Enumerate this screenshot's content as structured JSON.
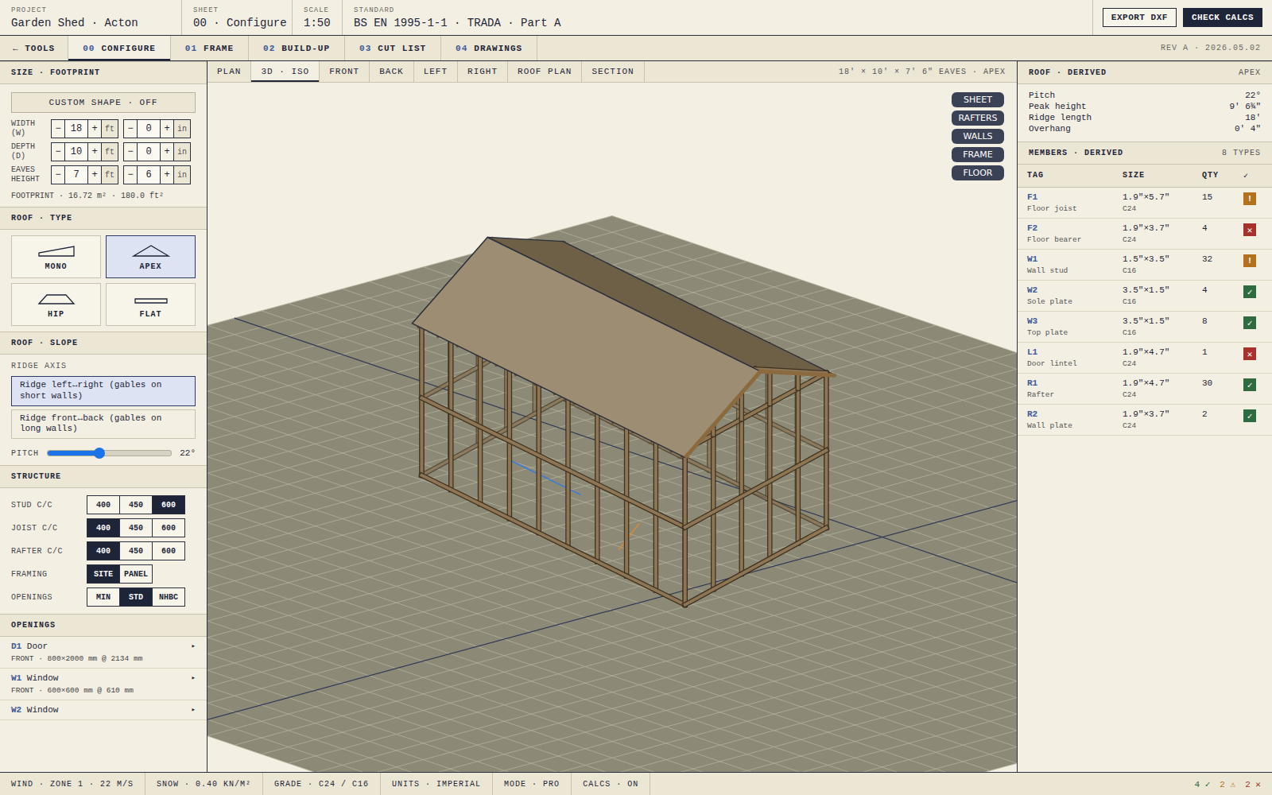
{
  "topbar": {
    "fields": [
      {
        "label": "PROJECT",
        "value": "Garden Shed · Acton"
      },
      {
        "label": "SHEET",
        "value": "00 · Configure"
      },
      {
        "label": "SCALE",
        "value": "1:50"
      },
      {
        "label": "STANDARD",
        "value": "BS EN 1995-1-1 · TRADA · Part A"
      }
    ],
    "buttons": [
      {
        "label": "EXPORT DXF",
        "primary": false
      },
      {
        "label": "CHECK CALCS",
        "primary": true
      }
    ]
  },
  "tabs": {
    "back": "← TOOLS",
    "items": [
      {
        "num": "00",
        "label": "CONFIGURE",
        "selected": true
      },
      {
        "num": "01",
        "label": "FRAME",
        "selected": false
      },
      {
        "num": "02",
        "label": "BUILD-UP",
        "selected": false
      },
      {
        "num": "03",
        "label": "CUT LIST",
        "selected": false
      },
      {
        "num": "04",
        "label": "DRAWINGS",
        "selected": false
      }
    ],
    "revision": "REV A · 2026.05.02"
  },
  "sidebar": {
    "size": {
      "title": "SIZE · FOOTPRINT",
      "custom_shape": "CUSTOM SHAPE · OFF",
      "minus": "−",
      "plus": "+",
      "ft_unit": "ft",
      "in_unit": "in",
      "dims": [
        {
          "label": "WIDTH (W)",
          "ft": "18",
          "in": "0"
        },
        {
          "label": "DEPTH (D)",
          "ft": "10",
          "in": "0"
        },
        {
          "label": "EAVES HEIGHT",
          "ft": "7",
          "in": "6"
        }
      ],
      "footprint": "FOOTPRINT · 16.72 m² · 180.0 ft²"
    },
    "roof_type": {
      "title": "ROOF · TYPE",
      "types": [
        {
          "label": "MONO",
          "kind": "mono",
          "selected": false
        },
        {
          "label": "APEX",
          "kind": "apex",
          "selected": true
        },
        {
          "label": "HIP",
          "kind": "hip",
          "selected": false
        },
        {
          "label": "FLAT",
          "kind": "flat",
          "selected": false
        }
      ]
    },
    "slope": {
      "title": "ROOF · SLOPE",
      "ridge_label": "RIDGE AXIS",
      "options": [
        {
          "label": "Ridge left↔right (gables on short walls)",
          "selected": true
        },
        {
          "label": "Ridge front↔back (gables on long walls)",
          "selected": false
        }
      ],
      "pitch": {
        "label": "PITCH",
        "level": 0.42,
        "reading": "22°"
      }
    },
    "structure": {
      "title": "STRUCTURE",
      "rows": [
        {
          "label": "STUD C/C",
          "options": [
            {
              "label": "400",
              "selected": false
            },
            {
              "label": "450",
              "selected": false
            },
            {
              "label": "600",
              "selected": true
            }
          ]
        },
        {
          "label": "JOIST C/C",
          "options": [
            {
              "label": "400",
              "selected": true
            },
            {
              "label": "450",
              "selected": false
            },
            {
              "label": "600",
              "selected": false
            }
          ]
        },
        {
          "label": "RAFTER C/C",
          "options": [
            {
              "label": "400",
              "selected": true
            },
            {
              "label": "450",
              "selected": false
            },
            {
              "label": "600",
              "selected": false
            }
          ]
        },
        {
          "label": "FRAMING",
          "options": [
            {
              "label": "SITE",
              "selected": true
            },
            {
              "label": "PANEL",
              "selected": false
            }
          ]
        },
        {
          "label": "OPENINGS",
          "options": [
            {
              "label": "MIN",
              "selected": false
            },
            {
              "label": "STD",
              "selected": true
            },
            {
              "label": "NHBC",
              "selected": false
            }
          ]
        }
      ]
    },
    "openings": {
      "title": "OPENINGS",
      "items": [
        {
          "tag": "D1",
          "name": "Door",
          "arrow": "▸",
          "detail": "FRONT · 800×2000 mm @ 2134 mm"
        },
        {
          "tag": "W1",
          "name": "Window",
          "arrow": "▸",
          "detail": "FRONT · 600×600 mm @ 610 mm"
        },
        {
          "tag": "W2",
          "name": "Window",
          "arrow": "▸",
          "detail": ""
        }
      ]
    }
  },
  "viewport": {
    "views": [
      {
        "label": "PLAN",
        "selected": false
      },
      {
        "label": "3D · ISO",
        "selected": true
      },
      {
        "label": "FRONT",
        "selected": false
      },
      {
        "label": "BACK",
        "selected": false
      },
      {
        "label": "LEFT",
        "selected": false
      },
      {
        "label": "RIGHT",
        "selected": false
      },
      {
        "label": "ROOF PLAN",
        "selected": false
      },
      {
        "label": "SECTION",
        "selected": false
      }
    ],
    "summary": "18' × 10' × 7' 6\" EAVES · APEX",
    "layers": [
      {
        "label": "SHEET",
        "on": true
      },
      {
        "label": "RAFTERS",
        "on": true
      },
      {
        "label": "WALLS",
        "on": true
      },
      {
        "label": "FRAME",
        "on": true
      },
      {
        "label": "FLOOR",
        "on": true
      }
    ]
  },
  "right": {
    "roof": {
      "title": "ROOF · DERIVED",
      "badge": "APEX",
      "rows": [
        {
          "label": "Pitch",
          "value": "22°"
        },
        {
          "label": "Peak height",
          "value": "9' 6¾\""
        },
        {
          "label": "Ridge length",
          "value": "18'"
        },
        {
          "label": "Overhang",
          "value": "0' 4\""
        }
      ]
    },
    "members": {
      "title": "MEMBERS · DERIVED",
      "badge": "8 TYPES",
      "columns": [
        "TAG",
        "SIZE",
        "QTY",
        "✓"
      ],
      "rows": [
        {
          "tag": "F1",
          "name": "Floor joist",
          "size": "1.9\"×5.7\"",
          "grade": "C24",
          "qty": "15",
          "status": "warn",
          "mark": "!",
          "color": "#b5701c"
        },
        {
          "tag": "F2",
          "name": "Floor bearer",
          "size": "1.9\"×3.7\"",
          "grade": "C24",
          "qty": "4",
          "status": "fail",
          "mark": "✕",
          "color": "#a8322b"
        },
        {
          "tag": "W1",
          "name": "Wall stud",
          "size": "1.5\"×3.5\"",
          "grade": "C16",
          "qty": "32",
          "status": "warn",
          "mark": "!",
          "color": "#b5701c"
        },
        {
          "tag": "W2",
          "name": "Sole plate",
          "size": "3.5\"×1.5\"",
          "grade": "C16",
          "qty": "4",
          "status": "ok",
          "mark": "✓",
          "color": "#2e6b3e"
        },
        {
          "tag": "W3",
          "name": "Top plate",
          "size": "3.5\"×1.5\"",
          "grade": "C16",
          "qty": "8",
          "status": "ok",
          "mark": "✓",
          "color": "#2e6b3e"
        },
        {
          "tag": "L1",
          "name": "Door lintel",
          "size": "1.9\"×4.7\"",
          "grade": "C24",
          "qty": "1",
          "status": "fail",
          "mark": "✕",
          "color": "#a8322b"
        },
        {
          "tag": "R1",
          "name": "Rafter",
          "size": "1.9\"×4.7\"",
          "grade": "C24",
          "qty": "30",
          "status": "ok",
          "mark": "✓",
          "color": "#2e6b3e"
        },
        {
          "tag": "R2",
          "name": "Wall plate",
          "size": "1.9\"×3.7\"",
          "grade": "C24",
          "qty": "2",
          "status": "ok",
          "mark": "✓",
          "color": "#2e6b3e"
        }
      ]
    }
  },
  "status_bar": {
    "items": [
      "WIND · ZONE 1 · 22 M/S",
      "SNOW · 0.40 KN/M²",
      "GRADE · C24 / C16",
      "UNITS · IMPERIAL",
      "MODE · PRO",
      "CALCS · ON"
    ],
    "counts": [
      {
        "text": "4 ✓",
        "color": "#2e6b3e"
      },
      {
        "text": "2 ⚠",
        "color": "#b5701c"
      },
      {
        "text": "2 ✕",
        "color": "#a8322b"
      }
    ]
  }
}
